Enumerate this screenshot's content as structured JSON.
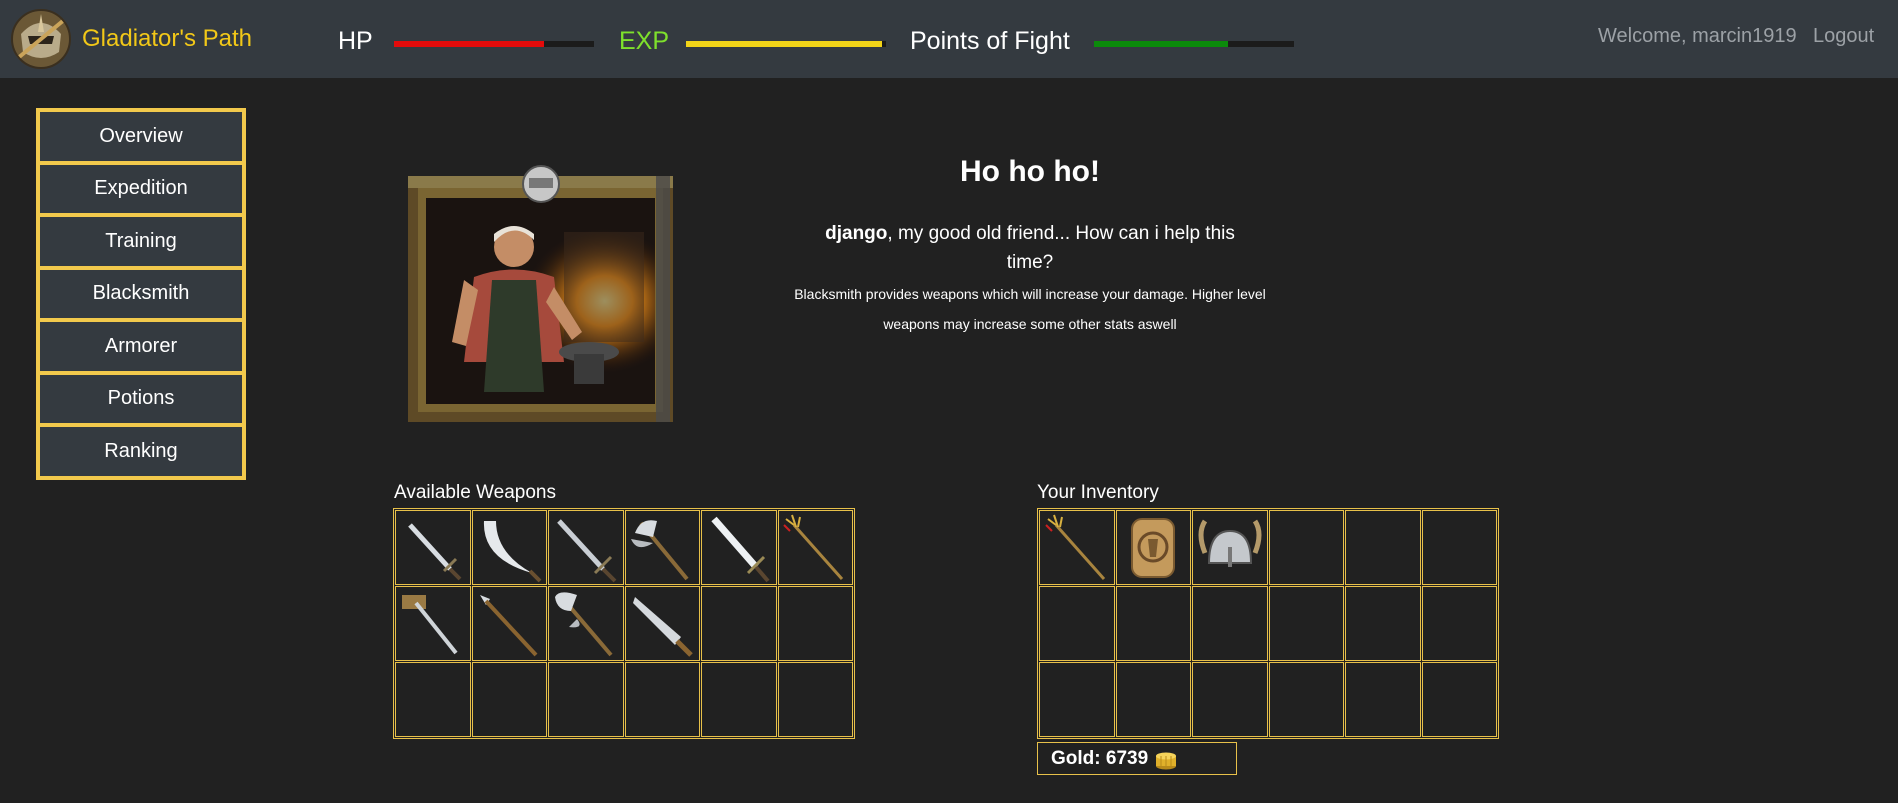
{
  "brand": {
    "name": "Gladiator's Path",
    "logo_icon": "gladiator-helmet-logo-icon"
  },
  "stats": {
    "hp": {
      "label": "HP",
      "fill_percent": 75,
      "color": "#e30b0b"
    },
    "exp": {
      "label": "EXP",
      "fill_percent": 98,
      "color": "#f2d418"
    },
    "pof": {
      "label": "Points of Fight",
      "fill_percent": 67,
      "color": "#0b8a0b"
    }
  },
  "user": {
    "welcome": "Welcome, marcin1919",
    "logout": "Logout"
  },
  "sidebar": {
    "items": [
      {
        "label": "Overview"
      },
      {
        "label": "Expedition"
      },
      {
        "label": "Training"
      },
      {
        "label": "Blacksmith"
      },
      {
        "label": "Armorer"
      },
      {
        "label": "Potions"
      },
      {
        "label": "Ranking"
      }
    ]
  },
  "npc": {
    "portrait_icon": "blacksmith-portrait-icon",
    "title": "Ho ho ho!",
    "player_name": "django",
    "greeting_rest": ", my good old friend... How can i help this time?",
    "description": "Blacksmith provides weapons which will increase your damage. Higher level weapons may increase some other stats aswell"
  },
  "weapons": {
    "title": "Available Weapons",
    "slots": [
      "short-sword-icon",
      "scimitar-icon",
      "long-sword-icon",
      "axe-icon",
      "broadsword-icon",
      "trident-icon",
      "hammer-icon",
      "spear-icon",
      "double-axe-icon",
      "machete-icon",
      "",
      "",
      "",
      "",
      "",
      "",
      "",
      ""
    ]
  },
  "inventory": {
    "title": "Your Inventory",
    "slots": [
      "trident-icon",
      "amulet-icon",
      "horned-helmet-icon",
      "",
      "",
      "",
      "",
      "",
      "",
      "",
      "",
      "",
      "",
      "",
      "",
      "",
      "",
      ""
    ]
  },
  "gold": {
    "label": "Gold: 6739",
    "icon": "gold-coins-icon"
  }
}
